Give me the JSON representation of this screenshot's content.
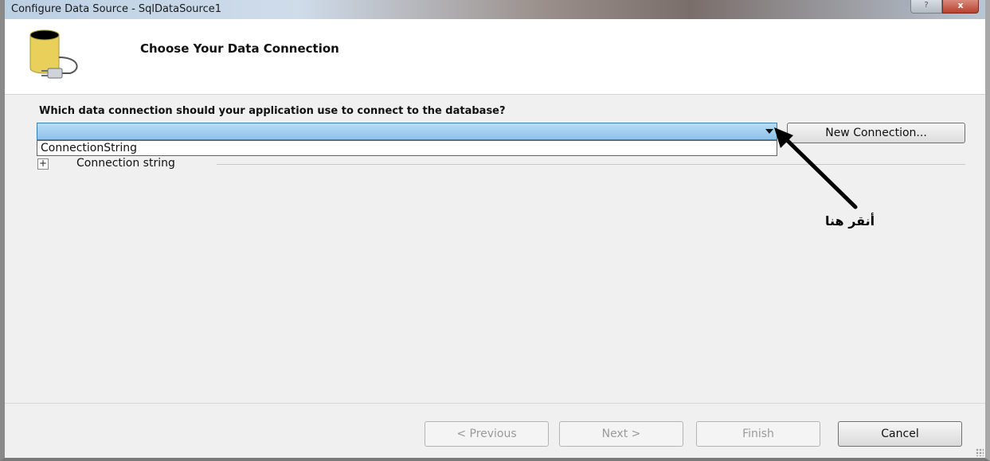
{
  "window": {
    "title": "Configure Data Source - SqlDataSource1",
    "help_label": "?",
    "close_label": "x"
  },
  "header": {
    "title": "Choose Your Data Connection",
    "icon": "database-plug-icon"
  },
  "main": {
    "question": "Which data connection should your application use to connect to the database?",
    "connection_combo": {
      "selected_value": "",
      "options": [
        "ConnectionString"
      ]
    },
    "new_connection_label": "New Connection...",
    "connection_string": {
      "expander_label": "+",
      "label": "Connection string"
    }
  },
  "annotation": {
    "text": "أنقر هنا"
  },
  "footer": {
    "previous_label": "< Previous",
    "next_label": "Next >",
    "finish_label": "Finish",
    "cancel_label": "Cancel"
  },
  "colors": {
    "combo_highlight": "#8cc2ea",
    "close_button": "#b8412e"
  }
}
